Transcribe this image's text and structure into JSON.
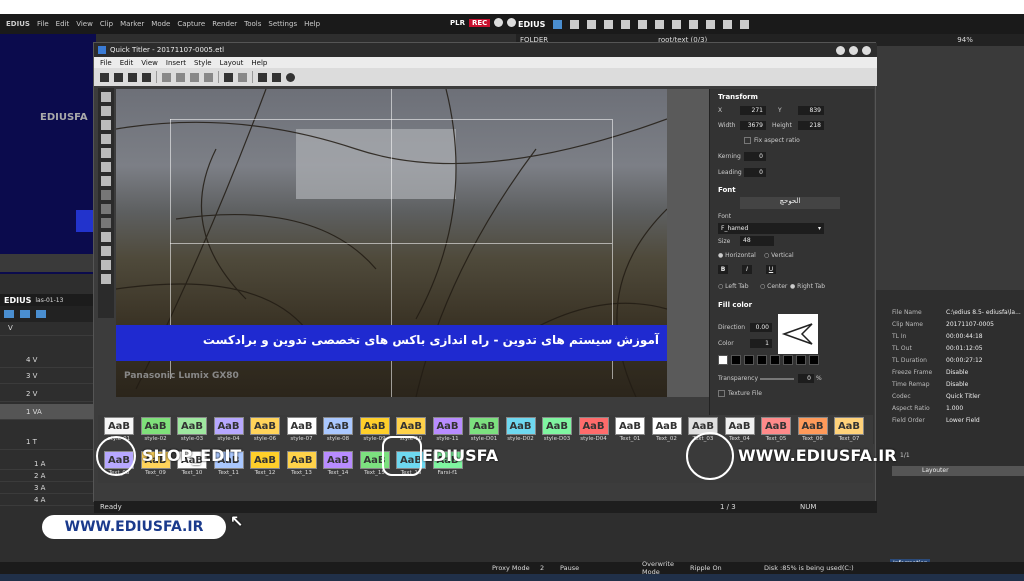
{
  "main_menu": {
    "logo": "EDIUS",
    "items": [
      "File",
      "Edit",
      "View",
      "Clip",
      "Marker",
      "Mode",
      "Capture",
      "Render",
      "Tools",
      "Settings",
      "Help"
    ]
  },
  "plr": {
    "label": "PLR",
    "rec": "REC"
  },
  "asset": {
    "logo": "EDIUS",
    "folder_label": "FOLDER",
    "path": "root/text (0/3)",
    "zoom": "94%"
  },
  "timeline": {
    "title": "EDIUS",
    "project": "las-01-13",
    "tracks": [
      "V",
      "4 V",
      "3 V",
      "2 V",
      "1 VA",
      "1 T",
      "1 A",
      "2 A",
      "3 A",
      "4 A"
    ]
  },
  "titler": {
    "title": "Quick Titler - 20171107-0005.etl",
    "menu": [
      "File",
      "Edit",
      "View",
      "Insert",
      "Style",
      "Layout",
      "Help"
    ],
    "subtitle": "آموزش سیستم های تدوین - راه اندازی باکس های تخصصی تدوین و برادکست",
    "camera_watermark": "Panasonic Lumix GX80",
    "status": {
      "ready": "Ready",
      "page": "1 / 3",
      "num": "NUM"
    }
  },
  "properties": {
    "transform": {
      "header": "Transform",
      "x_label": "X",
      "x": "271",
      "y_label": "Y",
      "y": "839",
      "width_label": "Width",
      "width": "3679",
      "height_label": "Height",
      "height": "218",
      "fix_aspect": "Fix aspect ratio",
      "kerning_label": "Kerning",
      "kerning": "0",
      "leading_label": "Leading",
      "leading": "0"
    },
    "font": {
      "header": "Font",
      "sample": "الحوحچ",
      "font_label": "Font",
      "font": "F_hamed",
      "size_label": "Size",
      "size": "48",
      "horizontal": "Horizontal",
      "vertical": "Vertical",
      "bold": "B",
      "italic": "I",
      "underline": "U",
      "left_tab": "Left Tab",
      "center": "Center",
      "right_tab": "Right Tab"
    },
    "fill": {
      "header": "Fill color",
      "direction_label": "Direction",
      "direction": "0.00",
      "color_label": "Color",
      "color": "1",
      "transparency_label": "Transparency",
      "transparency": "0",
      "pct": "%",
      "texture": "Texture File"
    }
  },
  "styles": {
    "row1": [
      "style-01",
      "style-02",
      "style-03",
      "style-04",
      "style-06",
      "style-07",
      "style-08",
      "style-09",
      "style-10",
      "style-11",
      "style-D01",
      "style-D02",
      "style-D03",
      "style-D04",
      "Text_01",
      "Text_02",
      "Text_03",
      "Text_04",
      "Text_05",
      "Text_06",
      "Text_07"
    ],
    "row2": [
      "Text_08",
      "Text_09",
      "Text_10",
      "Text_11",
      "Text_12",
      "Text_13",
      "Text_14",
      "Text_15",
      "Text_16",
      "Farsi-f1"
    ],
    "glyph": "AaB",
    "colors": [
      "#f6f6f6",
      "#7fe07a",
      "#9fe8a0",
      "#b7a8ff",
      "#ffd35a",
      "#ffffff",
      "#aac8ff",
      "#ffcf2a",
      "#ffd24a",
      "#b88cff",
      "#7ce07f",
      "#6ed8f0",
      "#7ff5a0",
      "#ff6b6b",
      "#ffffff",
      "#ffffff",
      "#e0e0e0",
      "#f0f0f0",
      "#ff8a8a",
      "#ff9a5a",
      "#ffd27a"
    ]
  },
  "info": {
    "rows": [
      [
        "File Name",
        "C:\\edius 8.5- ediusfa\\la..."
      ],
      [
        "Clip Name",
        "20171107-0005"
      ],
      [
        "TL In",
        "00:00:44:18"
      ],
      [
        "TL Out",
        "00:01:12:05"
      ],
      [
        "TL Duration",
        "00:00:27:12"
      ],
      [
        "Freeze Frame",
        "Disable"
      ],
      [
        "Time Remap",
        "Disable"
      ],
      [
        "Codec",
        "Quick Titler"
      ],
      [
        "Aspect Ratio",
        "1.000"
      ],
      [
        "Field Order",
        "Lower Field"
      ]
    ],
    "layouter": "Layouter",
    "tab": "Information",
    "counter": "1/1"
  },
  "statusbar": {
    "proxy": "Proxy Mode",
    "num": "2",
    "pause": "Pause",
    "overwrite": "Overwrite Mode",
    "ripple": "Ripple On",
    "disk": "Disk :85% is being used(C:)"
  },
  "overlay": {
    "shop": "SHOP_EDIT",
    "brand": "EDIUSFA",
    "site_top": "WWW.EDIUSFA.IR",
    "site_pill": "WWW.EDIUSFA.IR",
    "logo_text": "EDIUSFA"
  }
}
